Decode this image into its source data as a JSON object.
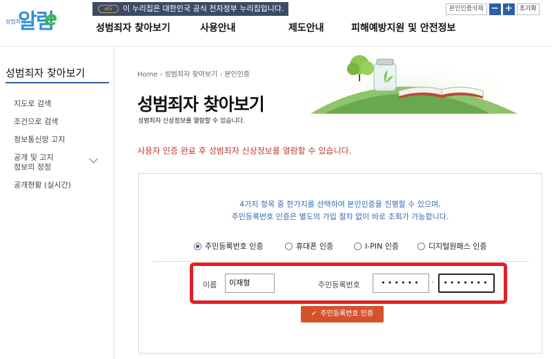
{
  "header": {
    "logo_small": "성범죄자",
    "logo_big": "알림",
    "logo_e": "e",
    "banner_badge": "eG",
    "banner_text": "이 누리집은 대한민국 공식 전자정부 누리집입니다.",
    "reset_auth_label": "본인인증삭제",
    "zoom_out_label": "−",
    "zoom_in_label": "+",
    "init_label": "초기화",
    "nav": [
      "성범죄자 찾아보기",
      "사용안내",
      "제도안내",
      "피해예방지원 및 안전정보"
    ]
  },
  "sidebar": {
    "title": "성범죄자 찾아보기",
    "items": [
      {
        "label": "지도로 검색"
      },
      {
        "label": "조건으로 검색"
      },
      {
        "label": "정보통신망 고지"
      },
      {
        "label": "공개 및 고지\n정보의 정정"
      },
      {
        "label": "공개현황 (실시간)"
      }
    ]
  },
  "breadcrumb": [
    "Home",
    "성범죄자 찾아보기",
    "본인인증"
  ],
  "page": {
    "title": "성범죄자 찾아보기",
    "subtitle": "성범죄자 신상정보를 열람할 수 있습니다.",
    "notice": "사용자 인증 완료 후 성범죄자 신상정보를 열람할 수 있습니다."
  },
  "auth": {
    "desc1": "4가지 항목 중 한가지를 선택하여 본인인증을 진행할 수 있으며,",
    "desc2": "주민등록번호 인증은 별도의 가입 절차 없이 바로 조회가 가능합니다.",
    "methods": [
      {
        "label": "주민등록번호 인증",
        "selected": true
      },
      {
        "label": "휴대폰 인증",
        "selected": false
      },
      {
        "label": "I-PIN 인증",
        "selected": false
      },
      {
        "label": "디지털원패스 인증",
        "selected": false
      }
    ],
    "name_label": "이름",
    "name_value": "이재형",
    "rrn_label": "주민등록번호",
    "rrn_front_masked": "••••••",
    "rrn_separator": "-",
    "rrn_back_masked": "•••••••",
    "submit_label": "주민등록번호 인증"
  },
  "colors": {
    "brand_blue": "#2e5ea6",
    "notice_red": "#c0392b",
    "highlight_red": "#e41e26",
    "button_orange": "#d4532e"
  }
}
